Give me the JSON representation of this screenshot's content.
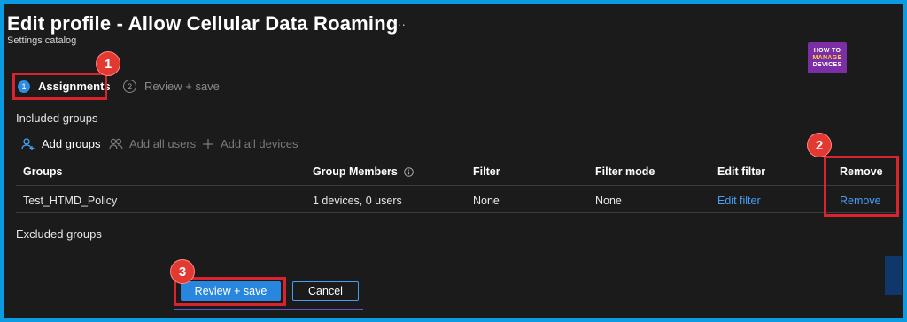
{
  "header": {
    "title": "Edit profile - Allow Cellular Data Roaming",
    "more": "...",
    "subtitle": "Settings catalog"
  },
  "logo": {
    "line1": "HOW TO",
    "line2": "MANAGE",
    "line3": "DEVICES"
  },
  "steps": [
    {
      "number": "1",
      "label": "Assignments",
      "active": true
    },
    {
      "number": "2",
      "label": "Review + save",
      "active": false
    }
  ],
  "included": {
    "heading": "Included groups",
    "actions": [
      {
        "label": "Add groups",
        "icon": "person-add-icon",
        "enabled": true
      },
      {
        "label": "Add all users",
        "icon": "people-icon",
        "enabled": false
      },
      {
        "label": "Add all devices",
        "icon": "plus-icon",
        "enabled": false
      }
    ],
    "table": {
      "columns": [
        "Groups",
        "Group Members",
        "Filter",
        "Filter mode",
        "Edit filter",
        "Remove"
      ],
      "rows": [
        {
          "group": "Test_HTMD_Policy",
          "members": "1 devices, 0 users",
          "filter": "None",
          "filter_mode": "None",
          "edit_filter": "Edit filter",
          "remove": "Remove"
        }
      ]
    }
  },
  "excluded": {
    "heading": "Excluded groups"
  },
  "footer": {
    "primary": "Review + save",
    "secondary": "Cancel"
  },
  "callouts": [
    "1",
    "2",
    "3"
  ],
  "colors": {
    "accent": "#2886de",
    "link": "#479ef5",
    "callout": "#d9232d",
    "background": "#1b1b1b"
  }
}
